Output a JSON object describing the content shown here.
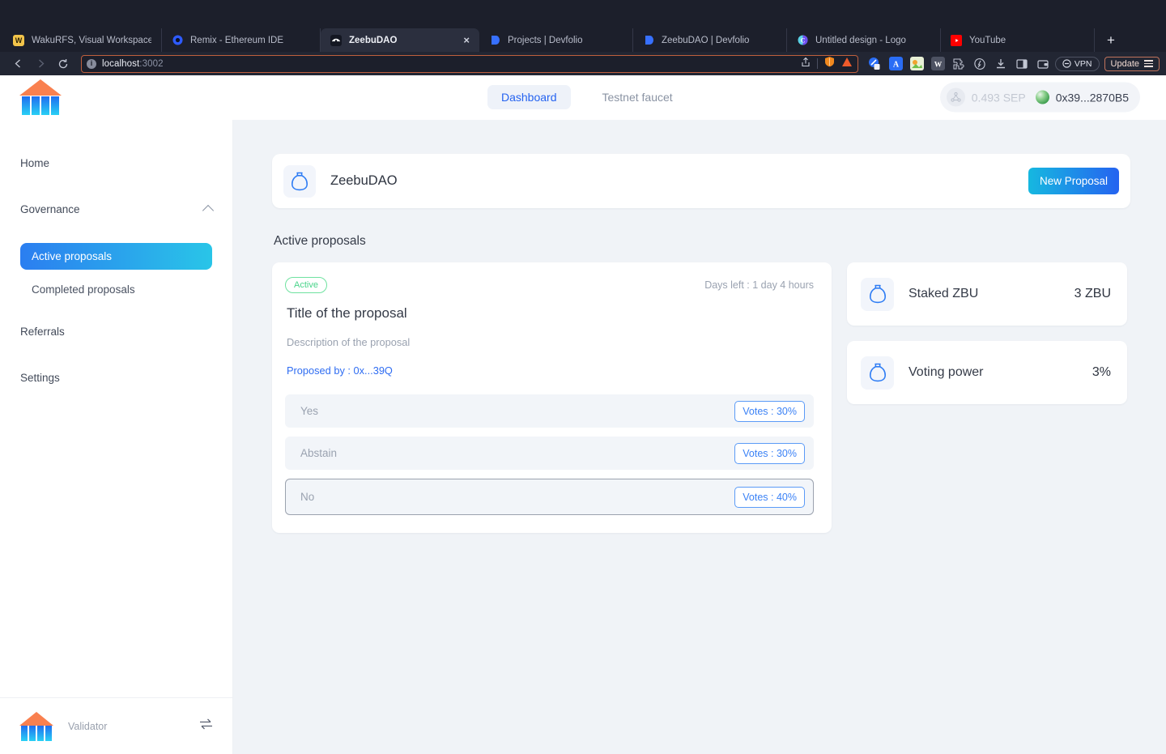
{
  "browser": {
    "tabs": [
      {
        "title": "WakuRFS, Visual Workspace for Inn",
        "favicon": "wakurfs-icon",
        "active": false
      },
      {
        "title": "Remix - Ethereum IDE",
        "favicon": "remix-icon",
        "active": false
      },
      {
        "title": "ZeebuDAO",
        "favicon": "zeebudao-icon",
        "active": true,
        "close": "×"
      },
      {
        "title": "Projects | Devfolio",
        "favicon": "devfolio-icon",
        "active": false
      },
      {
        "title": "ZeebuDAO | Devfolio",
        "favicon": "devfolio-icon",
        "active": false
      },
      {
        "title": "Untitled design - Logo",
        "favicon": "canva-icon",
        "active": false
      },
      {
        "title": "YouTube",
        "favicon": "youtube-icon",
        "active": false
      }
    ],
    "new_tab_label": "+",
    "url_host": "localhost",
    "url_port": ":3002",
    "vpn_label": "VPN",
    "update_label": "Update",
    "extensions": [
      "pin-icon",
      "grammarly-icon",
      "image-tool-icon",
      "wikipedia-icon",
      "puzzle-icon",
      "brave-shields-icon",
      "download-icon",
      "sidebar-icon",
      "wallet-icon"
    ]
  },
  "header": {
    "logo_name": "zeebu-logo",
    "tabs": [
      {
        "label": "Dashboard",
        "active": true
      },
      {
        "label": "Testnet faucet",
        "active": false
      }
    ],
    "wallet": {
      "balance": "0.493 SEP",
      "address": "0x39...2870B5"
    }
  },
  "sidebar": {
    "items": [
      {
        "label": "Home",
        "type": "link"
      },
      {
        "label": "Governance",
        "type": "group",
        "expanded": true
      },
      {
        "label": "Active proposals",
        "type": "sub",
        "selected": true
      },
      {
        "label": "Completed proposals",
        "type": "sub",
        "selected": false
      },
      {
        "label": "Referrals",
        "type": "link"
      },
      {
        "label": "Settings",
        "type": "link"
      }
    ],
    "footer": {
      "label": "Validator",
      "swap_icon": "swap-arrows-icon"
    }
  },
  "main": {
    "dao": {
      "name": "ZeebuDAO",
      "icon": "money-bag-icon",
      "new_proposal_label": "New Proposal"
    },
    "section_title": "Active proposals",
    "proposal": {
      "status": "Active",
      "days_left": "Days left : 1 day 4 hours",
      "title": "Title of the proposal",
      "description": "Description of the proposal",
      "proposed_by": "Proposed by : 0x...39Q",
      "options": [
        {
          "name": "Yes",
          "votes": "Votes : 30%",
          "focused": false
        },
        {
          "name": "Abstain",
          "votes": "Votes : 30%",
          "focused": false
        },
        {
          "name": "No",
          "votes": "Votes : 40%",
          "focused": true
        }
      ]
    },
    "stats": [
      {
        "icon": "money-bag-icon",
        "label": "Staked ZBU",
        "value": "3 ZBU"
      },
      {
        "icon": "money-bag-icon",
        "label": "Voting power",
        "value": "3%"
      }
    ]
  },
  "colors": {
    "accent_blue": "#2563f0",
    "accent_cyan": "#29c5e8",
    "status_green": "#49d48a",
    "page_bg": "#f0f3f7",
    "chrome_bg": "#1c1f2b",
    "url_border": "#bf5f3d"
  }
}
